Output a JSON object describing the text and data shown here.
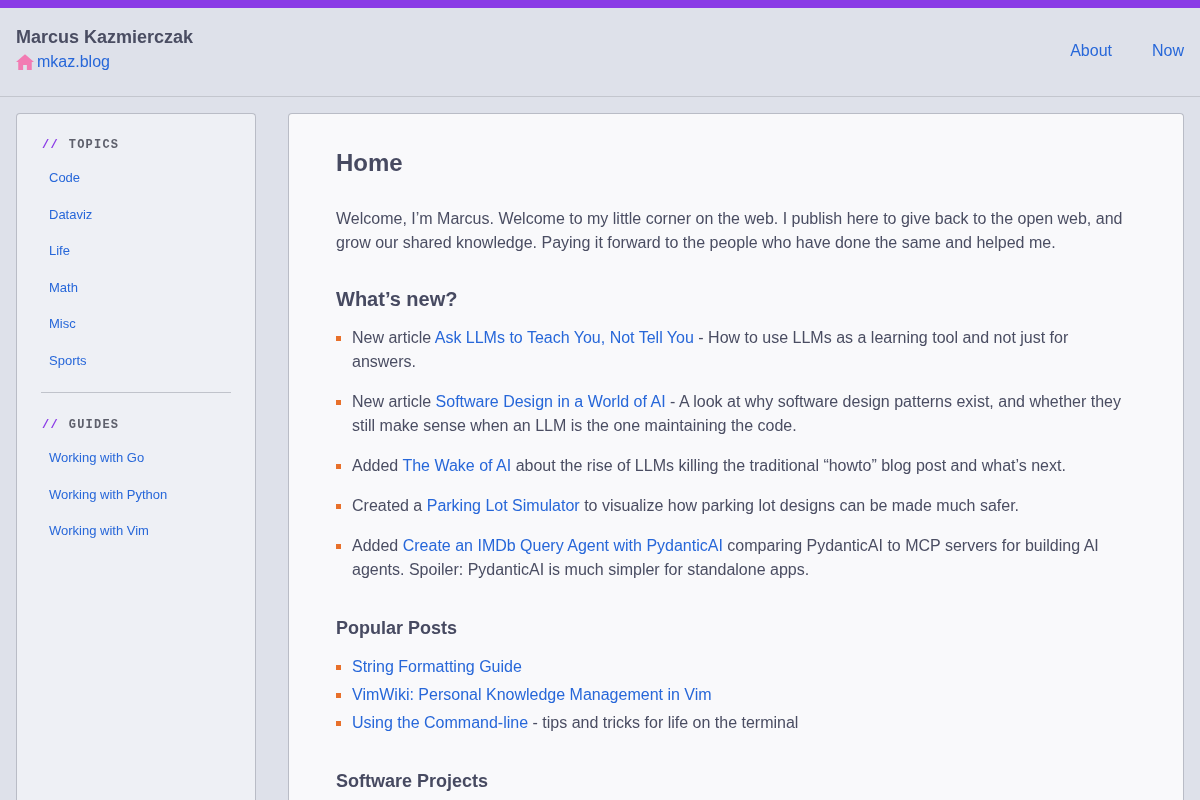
{
  "header": {
    "site_title": "Marcus Kazmierczak",
    "home_link": "mkaz.blog",
    "nav": [
      {
        "label": "About"
      },
      {
        "label": "Now"
      }
    ]
  },
  "sidebar": {
    "sections": [
      {
        "marker": "//",
        "heading": "TOPICS",
        "items": [
          {
            "label": "Code"
          },
          {
            "label": "Dataviz"
          },
          {
            "label": "Life"
          },
          {
            "label": "Math"
          },
          {
            "label": "Misc"
          },
          {
            "label": "Sports"
          }
        ]
      },
      {
        "marker": "//",
        "heading": "GUIDES",
        "items": [
          {
            "label": "Working with Go"
          },
          {
            "label": "Working with Python"
          },
          {
            "label": "Working with Vim"
          }
        ]
      }
    ]
  },
  "main": {
    "title": "Home",
    "intro": "Welcome, I’m Marcus. Welcome to my little corner on the web. I publish here to give back to the open web, and grow our shared knowledge. Paying it forward to the people who have done the same and helped me.",
    "sections": [
      {
        "heading": "What’s new?",
        "kind": "news",
        "items": [
          {
            "parts": [
              {
                "kind": "text",
                "text": "New article "
              },
              {
                "kind": "link",
                "text": "Ask LLMs to Teach You, Not Tell You"
              },
              {
                "kind": "text",
                "text": " - How to use LLMs as a learning tool and not just for answers."
              }
            ]
          },
          {
            "parts": [
              {
                "kind": "text",
                "text": "New article "
              },
              {
                "kind": "link",
                "text": "Software Design in a World of AI"
              },
              {
                "kind": "text",
                "text": " - A look at why software design patterns exist, and whether they still make sense when an LLM is the one maintaining the code."
              }
            ]
          },
          {
            "parts": [
              {
                "kind": "text",
                "text": "Added "
              },
              {
                "kind": "link",
                "text": "The Wake of AI"
              },
              {
                "kind": "text",
                "text": " about the rise of LLMs killing the traditional “howto” blog post and what’s next."
              }
            ]
          },
          {
            "parts": [
              {
                "kind": "text",
                "text": "Created a "
              },
              {
                "kind": "link",
                "text": "Parking Lot Simulator"
              },
              {
                "kind": "text",
                "text": " to visualize how parking lot designs can be made much safer."
              }
            ]
          },
          {
            "parts": [
              {
                "kind": "text",
                "text": "Added "
              },
              {
                "kind": "link",
                "text": "Create an IMDb Query Agent with PydanticAI"
              },
              {
                "kind": "text",
                "text": " comparing PydanticAI to MCP servers for building AI agents. Spoiler: PydanticAI is much simpler for standalone apps."
              }
            ]
          }
        ]
      },
      {
        "heading": "Popular Posts",
        "kind": "links",
        "items": [
          {
            "parts": [
              {
                "kind": "link",
                "text": "String Formatting Guide"
              }
            ]
          },
          {
            "parts": [
              {
                "kind": "link",
                "text": "VimWiki: Personal Knowledge Management in Vim"
              }
            ]
          },
          {
            "parts": [
              {
                "kind": "link",
                "text": "Using the Command-line"
              },
              {
                "kind": "text",
                "text": " - tips and tricks for life on the terminal"
              }
            ]
          }
        ]
      },
      {
        "heading": "Software Projects",
        "kind": "links"
      }
    ]
  }
}
